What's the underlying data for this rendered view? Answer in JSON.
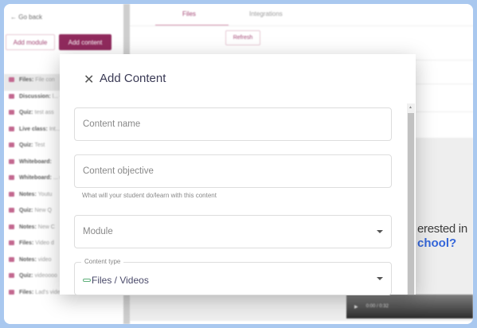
{
  "sidebar": {
    "go_back": "Go back",
    "add_module": "Add module",
    "add_content": "Add content",
    "items": [
      {
        "type": "Files:",
        "title": "File con"
      },
      {
        "type": "Discussion:",
        "title": "l... - Discussion"
      },
      {
        "type": "Quiz:",
        "title": "test ass"
      },
      {
        "type": "Live class:",
        "title": "Int... class"
      },
      {
        "type": "Quiz:",
        "title": "Test"
      },
      {
        "type": "Whiteboard:",
        "title": ""
      },
      {
        "type": "Whiteboard:",
        "title": "... ntent"
      },
      {
        "type": "Notes:",
        "title": "Youtu"
      },
      {
        "type": "Quiz:",
        "title": "New Q"
      },
      {
        "type": "Notes:",
        "title": "New C"
      },
      {
        "type": "Files:",
        "title": "Video d"
      },
      {
        "type": "Notes:",
        "title": "video"
      },
      {
        "type": "Quiz:",
        "title": "videoooo"
      },
      {
        "type": "Files:",
        "title": "Lad's video"
      }
    ]
  },
  "main": {
    "tabs": [
      "Files",
      "Integrations"
    ],
    "refresh": "Refresh",
    "promo_line1": "erested in",
    "promo_line2": "chool?",
    "video_time": "0:00 / 0:32"
  },
  "modal": {
    "title": "Add Content",
    "close_icon": "close-icon",
    "content_name_placeholder": "Content name",
    "content_objective_placeholder": "Content objective",
    "objective_helper": "What will your student do/learn with this content",
    "module_placeholder": "Module",
    "content_type_label": "Content type",
    "content_type_value": "Files / Videos"
  },
  "colors": {
    "accent": "#8b1f55",
    "frame": "#a9c8ef",
    "link_blue": "#2a5ed8"
  }
}
